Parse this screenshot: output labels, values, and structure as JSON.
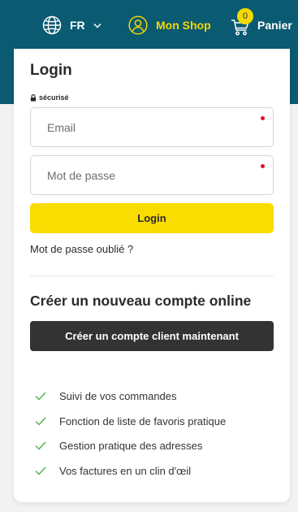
{
  "header": {
    "language": "FR",
    "shop_label": "Mon Shop",
    "cart_label": "Panier",
    "cart_count": "0",
    "colors": {
      "bar": "#0a5a72",
      "accent": "#f5d800"
    },
    "icons": [
      "globe-icon",
      "chevron-down-icon",
      "user-icon",
      "cart-icon"
    ]
  },
  "login": {
    "title": "Login",
    "secure_label": "sécurisé",
    "email_placeholder": "Email",
    "password_placeholder": "Mot de passe",
    "submit_label": "Login",
    "forgot_label": "Mot de passe oublié ?"
  },
  "register": {
    "title": "Créer un nouveau compte online",
    "button_label": "Créer un compte client maintenant",
    "benefits": [
      "Suivi de vos commandes",
      "Fonction de liste de favoris pratique",
      "Gestion pratique des adresses",
      "Vos factures en un clin d'œil"
    ]
  }
}
